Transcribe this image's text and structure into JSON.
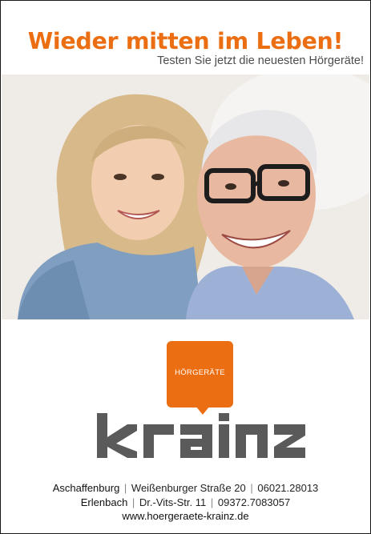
{
  "ad": {
    "headline": "Wieder mitten im Leben!",
    "subline": "Testen Sie jetzt die neuesten Hörgeräte!",
    "badge_text": "HÖRGERÄTE",
    "brand": "krainz",
    "brand_color": "#ec6e12",
    "wordmark_color": "#5a5a5a",
    "locations": [
      {
        "city": "Aschaffenburg",
        "street": "Weißenburger Straße 20",
        "phone": "06021.28013"
      },
      {
        "city": "Erlenbach",
        "street": "Dr.-Vits-Str. 11",
        "phone": "09372.7083057"
      }
    ],
    "website": "www.hoergeraete-krainz.de"
  }
}
